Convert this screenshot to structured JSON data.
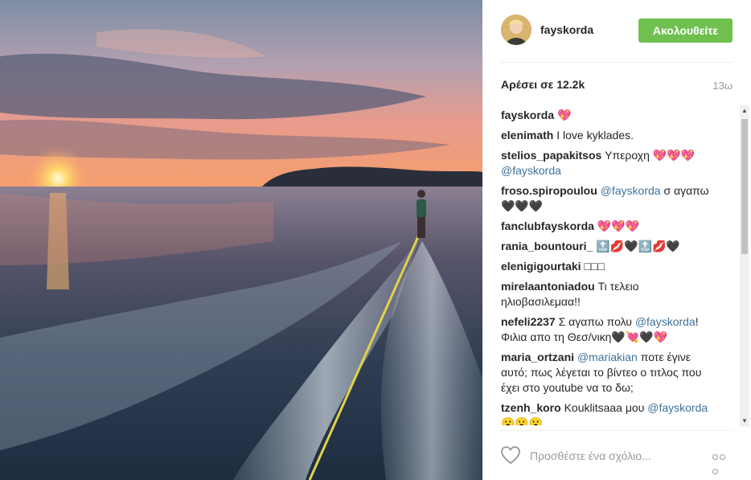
{
  "header": {
    "username": "fayskorda",
    "follow_label": "Ακολουθείτε"
  },
  "stats": {
    "likes": "Αρέσει σε 12.2k",
    "time": "13ω"
  },
  "comments": [
    {
      "user": "fayskorda",
      "parts": [
        {
          "t": "text",
          "v": " 💖"
        }
      ]
    },
    {
      "user": "elenimath",
      "parts": [
        {
          "t": "text",
          "v": " I love kyklades."
        }
      ]
    },
    {
      "user": "stelios_papakitsos",
      "parts": [
        {
          "t": "text",
          "v": " Υπεροχη 💖💖💖 "
        },
        {
          "t": "mention",
          "v": "@fayskorda"
        }
      ]
    },
    {
      "user": "froso.spiropoulou",
      "parts": [
        {
          "t": "text",
          "v": " "
        },
        {
          "t": "mention",
          "v": "@fayskorda"
        },
        {
          "t": "text",
          "v": " σ αγαπω 🖤🖤🖤"
        }
      ]
    },
    {
      "user": "fanclubfayskorda",
      "parts": [
        {
          "t": "text",
          "v": " 💖💖💖"
        }
      ]
    },
    {
      "user": "rania_bountouri_",
      "parts": [
        {
          "t": "text",
          "v": " 🔝💋🖤🔝💋🖤"
        }
      ]
    },
    {
      "user": "elenigigourtaki",
      "parts": [
        {
          "t": "text",
          "v": " □□□"
        }
      ]
    },
    {
      "user": "mirelaantoniadou",
      "parts": [
        {
          "t": "text",
          "v": " Τι τελειο ηλιοβασιλεμαα!!"
        }
      ]
    },
    {
      "user": "nefeli2237",
      "parts": [
        {
          "t": "text",
          "v": " Σ αγαπω πολυ "
        },
        {
          "t": "mention",
          "v": "@fayskorda"
        },
        {
          "t": "text",
          "v": "! Φιλια απο τη Θεσ/νικη🖤💘🖤💖"
        }
      ]
    },
    {
      "user": "maria_ortzani",
      "parts": [
        {
          "t": "text",
          "v": " "
        },
        {
          "t": "mention",
          "v": "@mariakian"
        },
        {
          "t": "text",
          "v": " ποτε έγινε αυτό; πως λέγεται το βίντεο ο τιτλος που έχει στο youtube να το δω;"
        }
      ]
    },
    {
      "user": "tzenh_koro",
      "parts": [
        {
          "t": "text",
          "v": " Kouklitsaaa μου "
        },
        {
          "t": "mention",
          "v": "@fayskorda"
        },
        {
          "t": "text",
          "v": " 😮😮😮"
        }
      ]
    }
  ],
  "footer": {
    "comment_placeholder": "Προσθέστε ένα σχόλιο..."
  },
  "colors": {
    "follow": "#70c050",
    "mention": "#3f729b",
    "muted": "#999999"
  },
  "icons": {
    "like": "heart-icon",
    "more": "more-options-icon",
    "avatar": "profile-avatar"
  }
}
